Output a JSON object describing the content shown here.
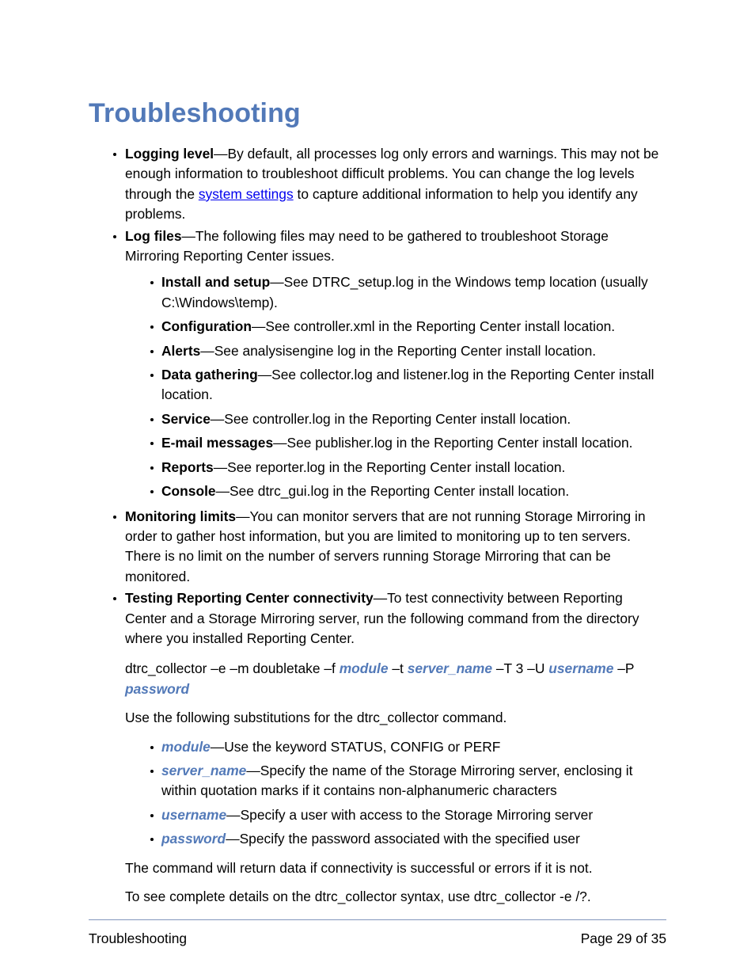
{
  "page": {
    "title": "Troubleshooting",
    "footer": {
      "left_label": "Troubleshooting",
      "right_label": "Page 29 of 35"
    },
    "accent_color": "#5279b8",
    "link_color": "#0000ee",
    "text_color": "#000000"
  },
  "bullets": {
    "logging_level": {
      "term": "Logging level",
      "dash": "—",
      "text_before_link": "By default, all processes log only errors and warnings. This may not be enough information to troubleshoot difficult problems. You can change the log levels through the ",
      "link_text": "system settings",
      "text_after_link": " to capture additional information to help you identify any problems."
    },
    "log_files": {
      "term": "Log files",
      "dash": "—",
      "text": "The following files may need to be gathered to troubleshoot Storage Mirroring Reporting Center issues.",
      "items": [
        {
          "term": "Install and setup",
          "dash": "—",
          "text": "See DTRC_setup.log in the Windows temp location (usually C:\\Windows\\temp)."
        },
        {
          "term": "Configuration",
          "dash": "—",
          "text": "See controller.xml in the Reporting Center install location."
        },
        {
          "term": "Alerts",
          "dash": "—",
          "text": "See analysisengine log in the Reporting Center install location."
        },
        {
          "term": "Data gathering",
          "dash": "—",
          "text": "See collector.log and listener.log in the Reporting Center install location."
        },
        {
          "term": "Service",
          "dash": "—",
          "text": "See controller.log in the Reporting Center install location."
        },
        {
          "term": "E-mail messages",
          "dash": "—",
          "text": "See publisher.log in the Reporting Center install location."
        },
        {
          "term": "Reports",
          "dash": "—",
          "text": "See reporter.log in the Reporting Center install location."
        },
        {
          "term": "Console",
          "dash": "—",
          "text": "See dtrc_gui.log in the Reporting Center install location."
        }
      ]
    },
    "monitoring_limits": {
      "term": "Monitoring limits",
      "dash": "—",
      "text": "You can monitor servers that are not running Storage Mirroring in order to gather host information, but you are limited to monitoring up to ten servers. There is no limit on the number of servers running Storage Mirroring that can be monitored."
    },
    "testing_connectivity": {
      "term": "Testing Reporting Center connectivity",
      "dash": "—",
      "text": "To test connectivity between Reporting Center and a Storage Mirroring server, run the following command from the directory where you installed Reporting Center.",
      "command": {
        "seg1": "dtrc_collector –e –m doubletake –f ",
        "ph_module": "module",
        "seg2": " –t ",
        "ph_server_name": "server_name",
        "seg3": " –T 3 –U ",
        "ph_username": "username",
        "seg4": " –P ",
        "ph_password": "password"
      },
      "substitutions_intro": "Use the following substitutions for the dtrc_collector command.",
      "substitutions": [
        {
          "placeholder": "module",
          "dash": "—",
          "text": "Use the keyword STATUS, CONFIG or PERF"
        },
        {
          "placeholder": "server_name",
          "dash": "—",
          "text": "Specify the name of the Storage Mirroring server, enclosing it within quotation marks if it contains non-alphanumeric characters"
        },
        {
          "placeholder": "username",
          "dash": "—",
          "text": "Specify a user with access to the Storage Mirroring server"
        },
        {
          "placeholder": "password",
          "dash": "—",
          "text": "Specify the password associated with the specified user"
        }
      ],
      "closing_para_1": "The command will return data if connectivity is successful or errors if it is not.",
      "closing_para_2": "To see complete details on the dtrc_collector syntax, use dtrc_collector -e /?."
    }
  }
}
